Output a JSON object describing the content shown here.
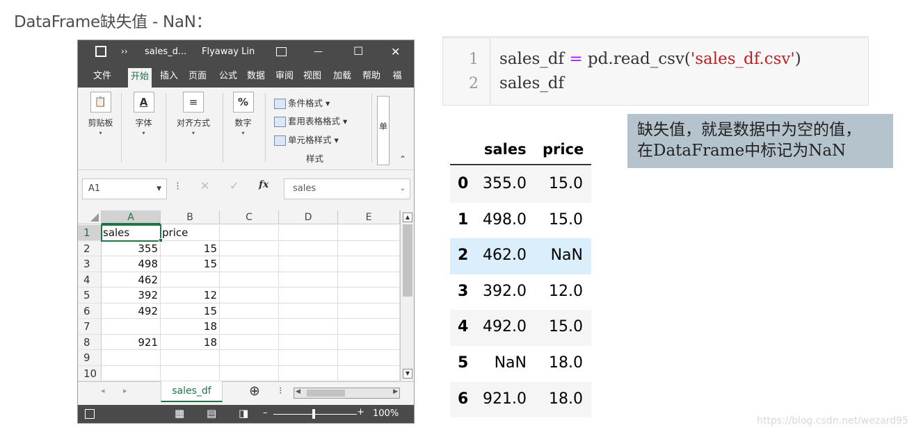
{
  "page_title": "DataFrame缺失值 - NaN：",
  "excel": {
    "title_bar": {
      "save_icon": "save-icon",
      "more": "››",
      "filename": "sales_d...",
      "user": "Flyaway Lin",
      "ribbon_opts_icon": "ribbon-display-icon",
      "minimize": "—",
      "maximize": "☐",
      "close": "✕"
    },
    "menu": [
      "文件",
      "开始",
      "插入",
      "页面",
      "公式",
      "数据",
      "审阅",
      "视图",
      "加载",
      "帮助",
      "福"
    ],
    "ribbon": {
      "paste": {
        "icon": "clipboard-icon",
        "glyph": "📋",
        "label": "剪贴板"
      },
      "font": {
        "icon": "font-icon",
        "glyph": "A",
        "label": "字体"
      },
      "align": {
        "icon": "align-icon",
        "glyph": "≡",
        "label": "对齐方式"
      },
      "number": {
        "icon": "percent-icon",
        "glyph": "%",
        "label": "数字"
      },
      "cond_format": "条件格式",
      "table_format": "套用表格格式",
      "cell_style": "单元格样式",
      "styles_group": "样式",
      "cells_short": "单"
    },
    "formula_bar": {
      "name_box": "A1",
      "fx": "fx",
      "value": "sales"
    },
    "columns": [
      "A",
      "B",
      "C",
      "D",
      "E"
    ],
    "rows": [
      {
        "n": "1",
        "a": "sales",
        "b": "price"
      },
      {
        "n": "2",
        "a": "355",
        "b": "15"
      },
      {
        "n": "3",
        "a": "498",
        "b": "15"
      },
      {
        "n": "4",
        "a": "462",
        "b": ""
      },
      {
        "n": "5",
        "a": "392",
        "b": "12"
      },
      {
        "n": "6",
        "a": "492",
        "b": "15"
      },
      {
        "n": "7",
        "a": "",
        "b": "18"
      },
      {
        "n": "8",
        "a": "921",
        "b": "18"
      },
      {
        "n": "9",
        "a": "",
        "b": ""
      },
      {
        "n": "10",
        "a": "",
        "b": ""
      }
    ],
    "sheet_tab": "sales_df",
    "zoom": "100%"
  },
  "code": {
    "line_numbers": [
      "1",
      "2"
    ],
    "line1": {
      "var": "sales_df ",
      "op": "=",
      "call": " pd.read_csv(",
      "str": "'sales_df.csv'",
      "close": ")"
    },
    "line2": "sales_df"
  },
  "dataframe": {
    "columns": [
      "sales",
      "price"
    ],
    "rows": [
      {
        "idx": "0",
        "sales": "355.0",
        "price": "15.0"
      },
      {
        "idx": "1",
        "sales": "498.0",
        "price": "15.0"
      },
      {
        "idx": "2",
        "sales": "462.0",
        "price": "NaN"
      },
      {
        "idx": "3",
        "sales": "392.0",
        "price": "12.0"
      },
      {
        "idx": "4",
        "sales": "492.0",
        "price": "15.0"
      },
      {
        "idx": "5",
        "sales": "NaN",
        "price": "18.0"
      },
      {
        "idx": "6",
        "sales": "921.0",
        "price": "18.0"
      }
    ],
    "highlight_row": 2
  },
  "note": {
    "line1": "缺失值，就是数据中为空的值，",
    "line2": "在DataFrame中标记为NaN"
  },
  "watermark": "https://blog.csdn.net/wezard95",
  "colors": {
    "excel_dark": "#4a4a4a",
    "excel_green": "#217346",
    "note_bg": "#b5c3cd",
    "row_highlight": "#dbeefb",
    "code_string": "#ba2121",
    "code_operator": "#aa22ff"
  }
}
